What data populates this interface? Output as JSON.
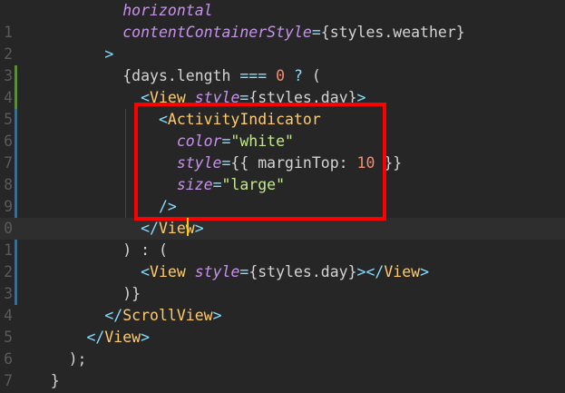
{
  "editor": {
    "lines": [
      {
        "num": "",
        "tokens": [
          {
            "t": "            ",
            "c": "t-plain"
          },
          {
            "t": "horizontal",
            "c": "t-attr"
          }
        ]
      },
      {
        "num": "1",
        "tokens": [
          {
            "t": "            ",
            "c": "t-plain"
          },
          {
            "t": "contentContainerStyle",
            "c": "t-attr"
          },
          {
            "t": "=",
            "c": "t-punct"
          },
          {
            "t": "{",
            "c": "t-brace"
          },
          {
            "t": "styles.weather",
            "c": "t-plain"
          },
          {
            "t": "}",
            "c": "t-brace"
          }
        ]
      },
      {
        "num": "2",
        "tokens": [
          {
            "t": "          ",
            "c": "t-plain"
          },
          {
            "t": ">",
            "c": "t-punct"
          }
        ]
      },
      {
        "num": "3",
        "tokens": [
          {
            "t": "            ",
            "c": "t-plain"
          },
          {
            "t": "{days.length ",
            "c": "t-plain"
          },
          {
            "t": "===",
            "c": "t-op"
          },
          {
            "t": " ",
            "c": "t-plain"
          },
          {
            "t": "0",
            "c": "t-number"
          },
          {
            "t": " ",
            "c": "t-plain"
          },
          {
            "t": "?",
            "c": "t-op"
          },
          {
            "t": " (",
            "c": "t-plain"
          }
        ]
      },
      {
        "num": "4",
        "tokens": [
          {
            "t": "              ",
            "c": "t-plain"
          },
          {
            "t": "<",
            "c": "t-punct"
          },
          {
            "t": "View",
            "c": "t-comp"
          },
          {
            "t": " ",
            "c": "t-plain"
          },
          {
            "t": "style",
            "c": "t-attr"
          },
          {
            "t": "=",
            "c": "t-punct"
          },
          {
            "t": "{",
            "c": "t-brace"
          },
          {
            "t": "styles.day",
            "c": "t-plain"
          },
          {
            "t": "}",
            "c": "t-brace"
          },
          {
            "t": ">",
            "c": "t-punct"
          }
        ]
      },
      {
        "num": "5",
        "tokens": [
          {
            "t": "                ",
            "c": "t-plain"
          },
          {
            "t": "<",
            "c": "t-punct"
          },
          {
            "t": "ActivityIndicator",
            "c": "t-comp"
          }
        ]
      },
      {
        "num": "6",
        "tokens": [
          {
            "t": "                  ",
            "c": "t-plain"
          },
          {
            "t": "color",
            "c": "t-attr"
          },
          {
            "t": "=",
            "c": "t-punct"
          },
          {
            "t": "\"white\"",
            "c": "t-string"
          }
        ]
      },
      {
        "num": "7",
        "tokens": [
          {
            "t": "                  ",
            "c": "t-plain"
          },
          {
            "t": "style",
            "c": "t-attr"
          },
          {
            "t": "=",
            "c": "t-punct"
          },
          {
            "t": "{{ ",
            "c": "t-brace"
          },
          {
            "t": "marginTop",
            "c": "t-plain"
          },
          {
            "t": ": ",
            "c": "t-plain"
          },
          {
            "t": "10",
            "c": "t-number"
          },
          {
            "t": " }}",
            "c": "t-brace"
          }
        ]
      },
      {
        "num": "8",
        "tokens": [
          {
            "t": "                  ",
            "c": "t-plain"
          },
          {
            "t": "size",
            "c": "t-attr"
          },
          {
            "t": "=",
            "c": "t-punct"
          },
          {
            "t": "\"large\"",
            "c": "t-string"
          }
        ]
      },
      {
        "num": "9",
        "tokens": [
          {
            "t": "                ",
            "c": "t-plain"
          },
          {
            "t": "/>",
            "c": "t-punct"
          }
        ]
      },
      {
        "num": "0",
        "tokens": [
          {
            "t": "              ",
            "c": "t-plain"
          },
          {
            "t": "</",
            "c": "t-punct"
          },
          {
            "t": "View",
            "c": "t-comp"
          },
          {
            "t": ">",
            "c": "t-punct"
          }
        ]
      },
      {
        "num": "1",
        "tokens": [
          {
            "t": "            ",
            "c": "t-plain"
          },
          {
            "t": ") : (",
            "c": "t-plain"
          }
        ]
      },
      {
        "num": "2",
        "tokens": [
          {
            "t": "              ",
            "c": "t-plain"
          },
          {
            "t": "<",
            "c": "t-punct"
          },
          {
            "t": "View",
            "c": "t-comp"
          },
          {
            "t": " ",
            "c": "t-plain"
          },
          {
            "t": "style",
            "c": "t-attr"
          },
          {
            "t": "=",
            "c": "t-punct"
          },
          {
            "t": "{",
            "c": "t-brace"
          },
          {
            "t": "styles.day",
            "c": "t-plain"
          },
          {
            "t": "}",
            "c": "t-brace"
          },
          {
            "t": "></",
            "c": "t-punct"
          },
          {
            "t": "View",
            "c": "t-comp"
          },
          {
            "t": ">",
            "c": "t-punct"
          }
        ]
      },
      {
        "num": "3",
        "tokens": [
          {
            "t": "            ",
            "c": "t-plain"
          },
          {
            "t": ")}",
            "c": "t-plain"
          }
        ]
      },
      {
        "num": "4",
        "tokens": [
          {
            "t": "          ",
            "c": "t-plain"
          },
          {
            "t": "</",
            "c": "t-punct"
          },
          {
            "t": "ScrollView",
            "c": "t-comp"
          },
          {
            "t": ">",
            "c": "t-punct"
          }
        ]
      },
      {
        "num": "5",
        "tokens": [
          {
            "t": "        ",
            "c": "t-plain"
          },
          {
            "t": "</",
            "c": "t-punct"
          },
          {
            "t": "View",
            "c": "t-comp"
          },
          {
            "t": ">",
            "c": "t-punct"
          }
        ]
      },
      {
        "num": "6",
        "tokens": [
          {
            "t": "      ",
            "c": "t-plain"
          },
          {
            "t": ");",
            "c": "t-plain"
          }
        ]
      },
      {
        "num": "7",
        "tokens": [
          {
            "t": "    ",
            "c": "t-plain"
          },
          {
            "t": "}",
            "c": "t-plain"
          }
        ]
      }
    ]
  },
  "highlight": {
    "color": "#ff0000"
  },
  "cursor": {
    "color": "#ffcc00"
  }
}
